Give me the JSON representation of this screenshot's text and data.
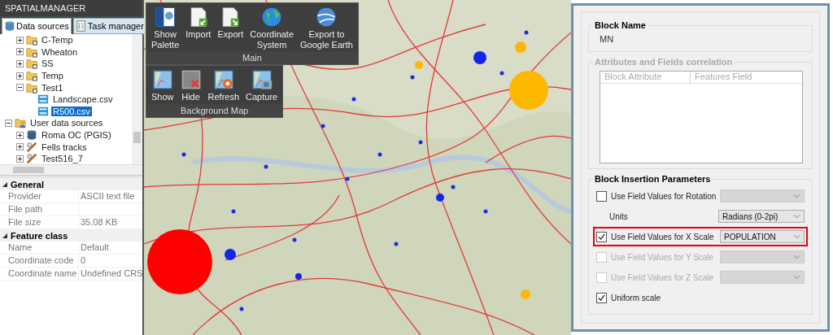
{
  "app_title": "SPATIALMANAGER",
  "tabs": [
    {
      "label": "Data sources",
      "kind": "db",
      "selected": true
    },
    {
      "label": "Task manager",
      "kind": "tasks",
      "selected": false
    }
  ],
  "tree": [
    {
      "label": "C-Temp",
      "kind": "folder",
      "expanded": false,
      "selected": false
    },
    {
      "label": "Wheaton",
      "kind": "folder",
      "expanded": false,
      "selected": false
    },
    {
      "label": "SS",
      "kind": "folder",
      "expanded": false,
      "selected": false
    },
    {
      "label": "Temp",
      "kind": "folder",
      "expanded": false,
      "selected": false
    },
    {
      "label": "Test1",
      "kind": "folder",
      "expanded": true,
      "selected": false,
      "children": [
        {
          "label": "Landscape.csv",
          "kind": "csv",
          "selected": false
        },
        {
          "label": "R500.csv",
          "kind": "csv",
          "selected": true
        }
      ]
    },
    {
      "label": "User data sources",
      "kind": "users",
      "expanded": true,
      "selected": false,
      "root": true,
      "children": [
        {
          "label": "Roma OC (PGIS)",
          "kind": "database",
          "expanded": false,
          "selected": false
        },
        {
          "label": "Fells tracks",
          "kind": "tracks",
          "expanded": false,
          "selected": false
        },
        {
          "label": "Test516_7",
          "kind": "tracks",
          "expanded": false,
          "selected": false
        }
      ]
    }
  ],
  "properties": [
    {
      "title": "General",
      "expanded": true,
      "rows": [
        {
          "name": "Provider",
          "value": "ASCII text file"
        },
        {
          "name": "File path"
        },
        {
          "name": "File size",
          "value": "35.08 KB"
        }
      ]
    },
    {
      "title": "Feature class",
      "expanded": true,
      "rows": [
        {
          "name": "Name",
          "value": "Default"
        },
        {
          "name": "Coordinate code",
          "value": "0"
        },
        {
          "name": "Coordinate name",
          "value": "Undefined CRS"
        }
      ]
    }
  ],
  "ribbon": [
    {
      "title": "Main",
      "buttons": [
        {
          "label": "Show\nPalette",
          "kind": "palette"
        },
        {
          "label": "Import",
          "kind": "import"
        },
        {
          "label": "Export",
          "kind": "export"
        },
        {
          "label": "Coordinate\nSystem",
          "kind": "globe"
        },
        {
          "label": "Export to\nGoogle Earth",
          "kind": "earth"
        }
      ]
    },
    {
      "title": "Background Map",
      "buttons": [
        {
          "label": "Show",
          "kind": "map-show"
        },
        {
          "label": "Hide",
          "kind": "map-hide"
        },
        {
          "label": "Refresh",
          "kind": "map-refresh"
        },
        {
          "label": "Capture",
          "kind": "map-capture"
        }
      ]
    }
  ],
  "dialog": {
    "block_name": {
      "title": "Block Name",
      "value": "MN"
    },
    "correlation": {
      "title": "Attributes and Fields correlation",
      "disabled": true,
      "columns": [
        "Block Attribute",
        "Features Field"
      ]
    },
    "insertion": {
      "title": "Block Insertion Parameters",
      "rows": [
        {
          "kind": "checkbox",
          "label": "Use Field Values for Rotation",
          "checked": false,
          "disabled": false,
          "highlighted": false,
          "combo_disabled": true
        },
        {
          "kind": "label",
          "label": "Units",
          "value": "Radians (0-2pi)",
          "highlighted": false,
          "combo_disabled": false
        },
        {
          "kind": "checkbox",
          "label": "Use Field Values for X Scale",
          "checked": true,
          "disabled": false,
          "highlighted": true,
          "value": "POPULATION",
          "combo_disabled": false
        },
        {
          "kind": "checkbox",
          "label": "Use Field Values for Y Scale",
          "checked": false,
          "disabled": true,
          "highlighted": false,
          "combo_disabled": true
        },
        {
          "kind": "checkbox",
          "label": "Use Field Values for Z Scale",
          "checked": false,
          "disabled": true,
          "highlighted": false,
          "combo_disabled": true
        },
        {
          "kind": "check-only",
          "label": "Uniform scale",
          "checked": true,
          "disabled": false
        }
      ]
    }
  }
}
